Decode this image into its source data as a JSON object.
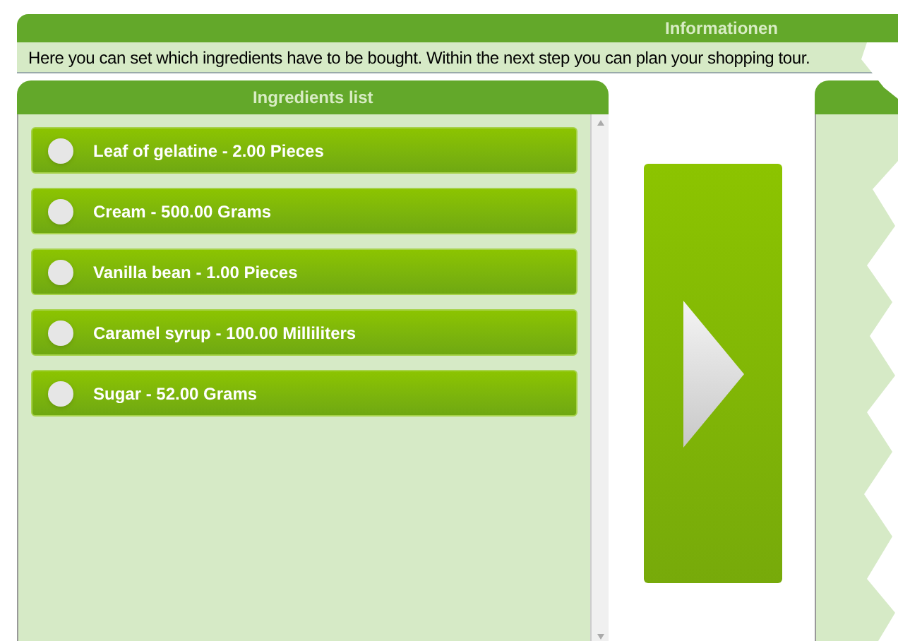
{
  "info": {
    "title": "Informationen",
    "text": "Here you can set which ingredients have to be bought. Within the next step you can plan your shopping tour."
  },
  "ingredients_panel": {
    "title": "Ingredients list",
    "items": [
      {
        "label": "Leaf of gelatine - 2.00 Pieces",
        "selected": false
      },
      {
        "label": "Cream - 500.00 Grams",
        "selected": false
      },
      {
        "label": "Vanilla bean - 1.00 Pieces",
        "selected": false
      },
      {
        "label": "Caramel syrup - 100.00 Milliliters",
        "selected": false
      },
      {
        "label": "Sugar - 52.00 Grams",
        "selected": false
      }
    ]
  }
}
